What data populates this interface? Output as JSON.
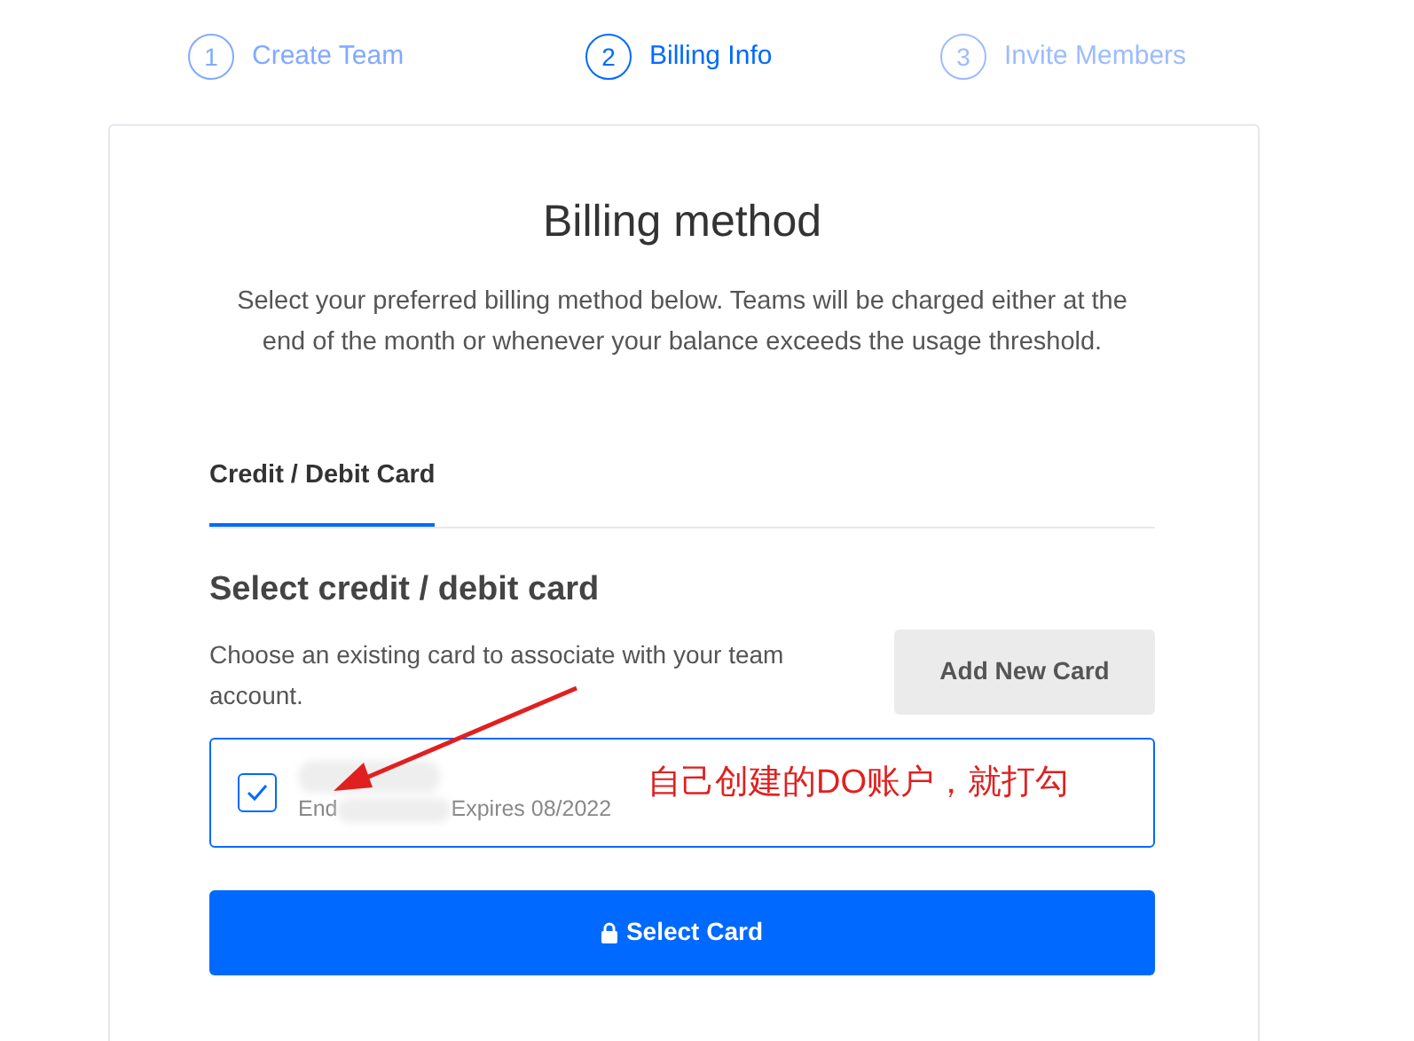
{
  "steps": [
    {
      "number": "1",
      "label": "Create Team",
      "completed": true,
      "selected": false
    },
    {
      "number": "2",
      "label": "Billing Info",
      "completed": false,
      "selected": true
    },
    {
      "number": "3",
      "label": "Invite Members",
      "completed": false,
      "selected": false
    }
  ],
  "title": "Billing method",
  "intro": "Select your preferred billing method below. Teams will be charged either at the end of the month or whenever your balance exceeds the usage threshold.",
  "tabs": [
    {
      "label": "Credit / Debit Card",
      "selected": true
    }
  ],
  "section_title": "Select credit / debit card",
  "section_text": "Choose an existing card to associate with your team account.",
  "add_button": "Add New Card",
  "cards": [
    {
      "checked": true,
      "ending_prefix": "End",
      "expires": "Expires 08/2022"
    }
  ],
  "submit_button": "Select Card",
  "annotation": {
    "text": "自己创建的DO账户，就打勾"
  }
}
